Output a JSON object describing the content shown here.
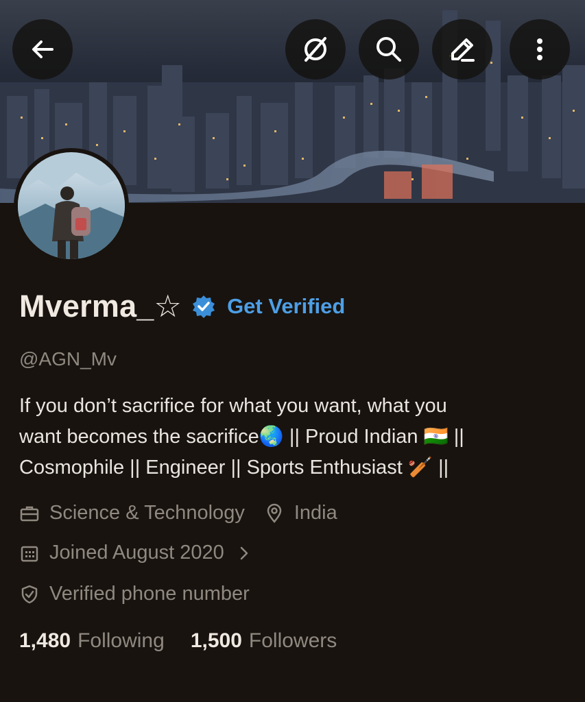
{
  "colors": {
    "background": "#18130f",
    "text_primary": "#efe9e1",
    "text_secondary": "#8f8980",
    "accent_blue": "#4d9fe6",
    "button_bg": "#141210"
  },
  "header": {
    "icons": [
      "arrow-left-icon",
      "no-grok-icon",
      "search-icon",
      "edit-icon",
      "more-vertical-icon"
    ]
  },
  "profile": {
    "name": "Mverma_☆",
    "get_verified_label": "Get Verified",
    "handle": "@AGN_Mv",
    "bio_line1": "If you don’t sacrifice for what you want, what you",
    "bio_line2a": "want becomes the sacrifice🌏  || Proud Indian 🇮🇳 ||",
    "bio_line3": "Cosmophile || Engineer || Sports Enthusiast 🏏 ||",
    "category": "Science & Technology",
    "location": "India",
    "joined": "Joined August 2020",
    "phone": "Verified phone number"
  },
  "stats": {
    "following_count": "1,480",
    "following_label": "Following",
    "followers_count": "1,500",
    "followers_label": "Followers"
  }
}
